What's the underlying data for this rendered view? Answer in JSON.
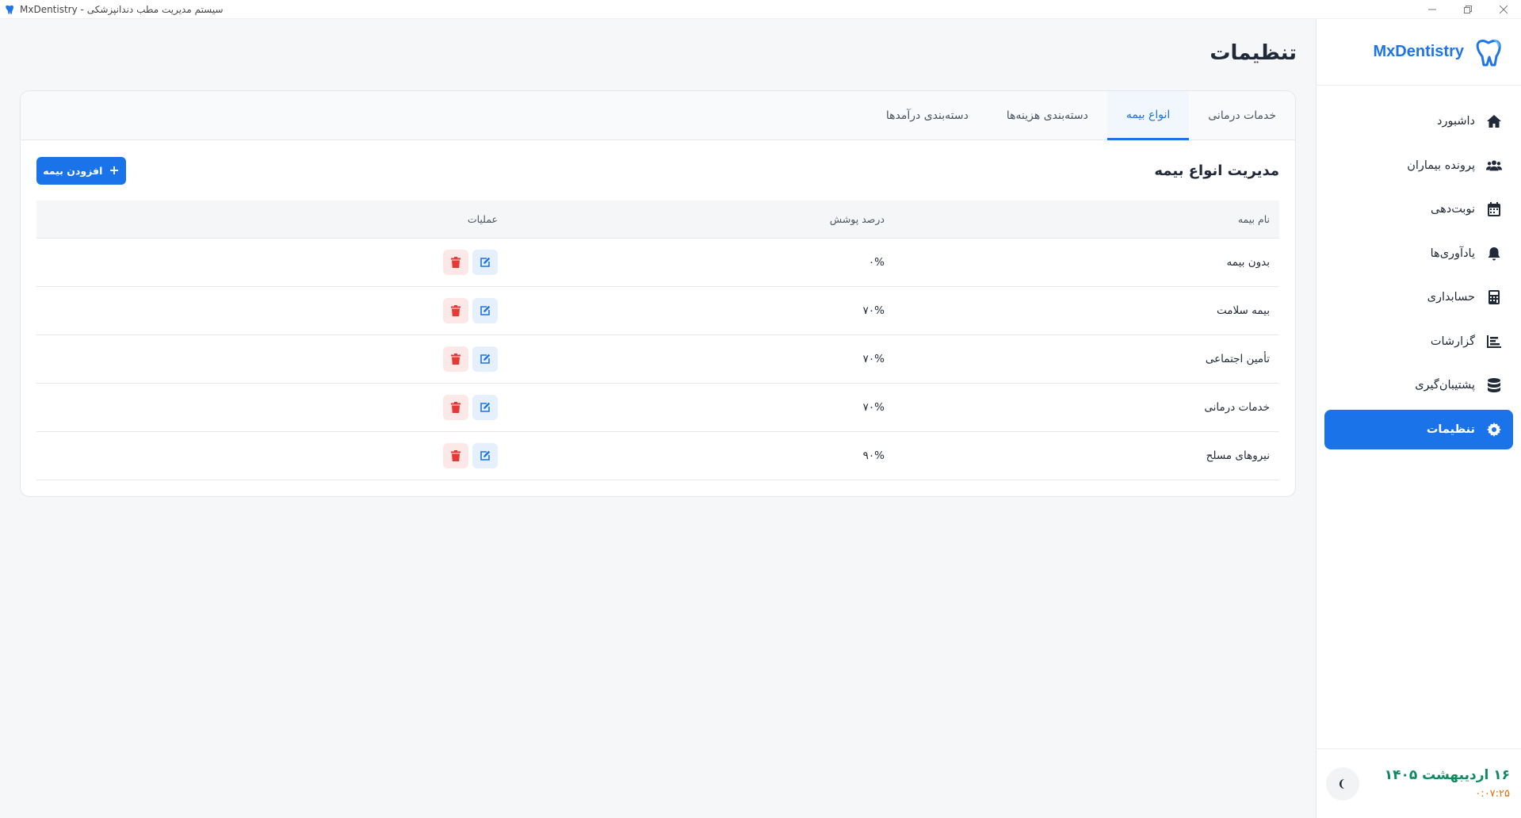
{
  "window": {
    "title": "MxDentistry - سیستم مدیریت مطب دندانپزشکی"
  },
  "sidebar": {
    "brand": "MxDentistry",
    "items": [
      {
        "label": "داشبورد",
        "icon": "home-icon"
      },
      {
        "label": "پرونده بیماران",
        "icon": "users-icon"
      },
      {
        "label": "نوبت‌دهی",
        "icon": "calendar-icon"
      },
      {
        "label": "یادآوری‌ها",
        "icon": "bell-icon"
      },
      {
        "label": "حسابداری",
        "icon": "calculator-icon"
      },
      {
        "label": "گزارشات",
        "icon": "chart-icon"
      },
      {
        "label": "پشتیبان‌گیری",
        "icon": "database-icon"
      },
      {
        "label": "تنظیمات",
        "icon": "gear-icon",
        "active": true
      }
    ],
    "footer": {
      "date": "۱۶ اردیبهشت ۱۴۰۵",
      "time": "۰:۰۷:۲۵"
    }
  },
  "main": {
    "page_title": "تنظیمات",
    "tabs": [
      {
        "label": "خدمات درمانی"
      },
      {
        "label": "انواع بیمه",
        "active": true
      },
      {
        "label": "دسته‌بندی هزینه‌ها"
      },
      {
        "label": "دسته‌بندی درآمدها"
      }
    ],
    "section_title": "مدیریت انواع بیمه",
    "add_button": "افزودن بیمه",
    "table": {
      "headers": [
        "نام بیمه",
        "درصد پوشش",
        "عملیات"
      ],
      "rows": [
        {
          "name": "بدون بیمه",
          "coverage": "۰%"
        },
        {
          "name": "بیمه سلامت",
          "coverage": "۷۰%"
        },
        {
          "name": "تأمین اجتماعی",
          "coverage": "۷۰%"
        },
        {
          "name": "خدمات درمانی",
          "coverage": "۷۰%"
        },
        {
          "name": "نیروهای مسلح",
          "coverage": "۹۰%"
        }
      ]
    }
  },
  "colors": {
    "accent": "#1a73e8",
    "date": "#0f8a5f",
    "time": "#e8710a",
    "delete": "#e53935"
  }
}
